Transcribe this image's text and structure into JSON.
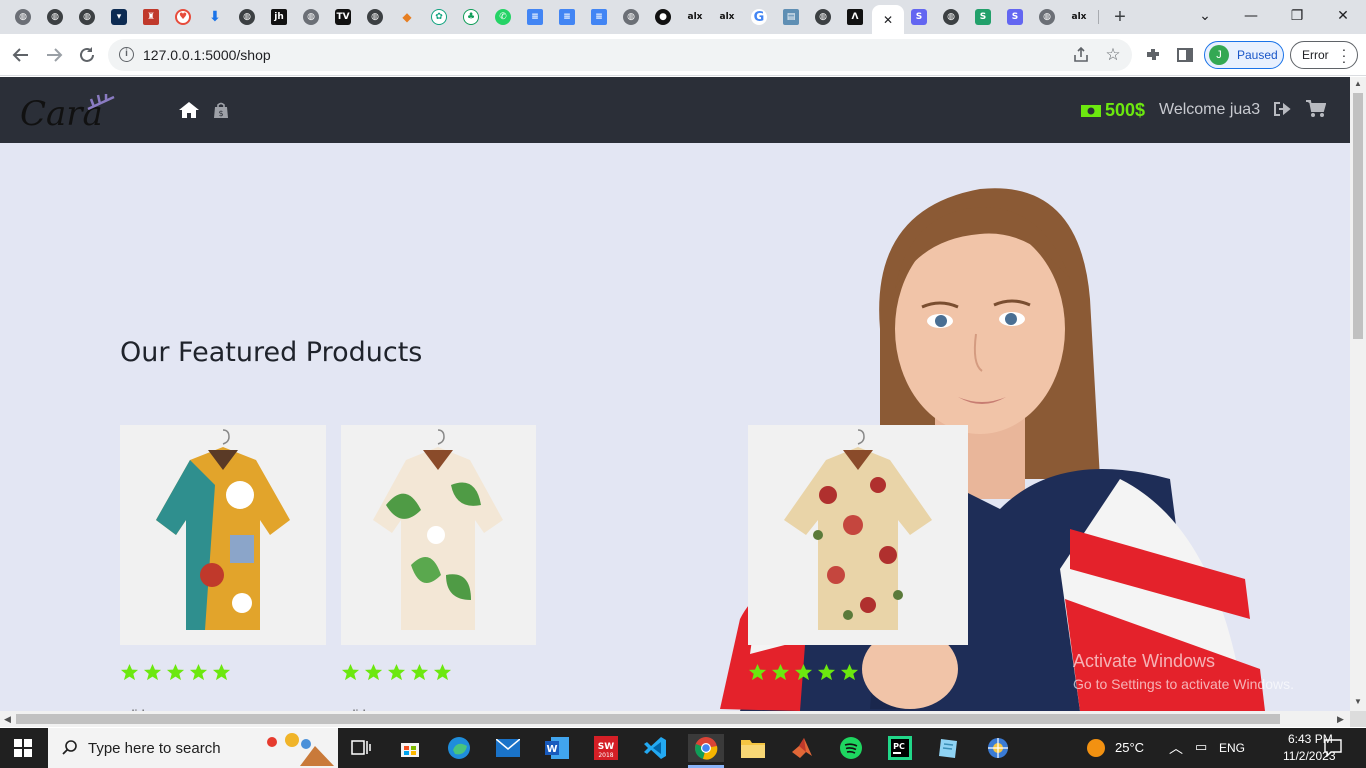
{
  "browser": {
    "url": "127.0.0.1:5000/shop",
    "profile_initial": "J",
    "profile_label": "Paused",
    "error_label": "Error",
    "new_tab": "+",
    "close_tab": "✕"
  },
  "navbar": {
    "balance": "500$",
    "welcome": "Welcome jua3"
  },
  "main": {
    "section_title": "Our Featured Products",
    "products": [
      {
        "rating": 5,
        "name": "adidas"
      },
      {
        "rating": 5,
        "name": "adidas"
      },
      {
        "rating": 5,
        "name": ""
      }
    ]
  },
  "watermark": {
    "line1": "Activate Windows",
    "line2": "Go to Settings to activate Windows."
  },
  "taskbar": {
    "search_placeholder": "Type here to search",
    "temperature": "25°C",
    "language": "ENG",
    "time": "6:43 PM",
    "date": "11/2/2023"
  },
  "colors": {
    "navbar_bg": "#2b2f38",
    "accent_green": "#6ce80f",
    "page_bg": "#e3e6f3"
  }
}
